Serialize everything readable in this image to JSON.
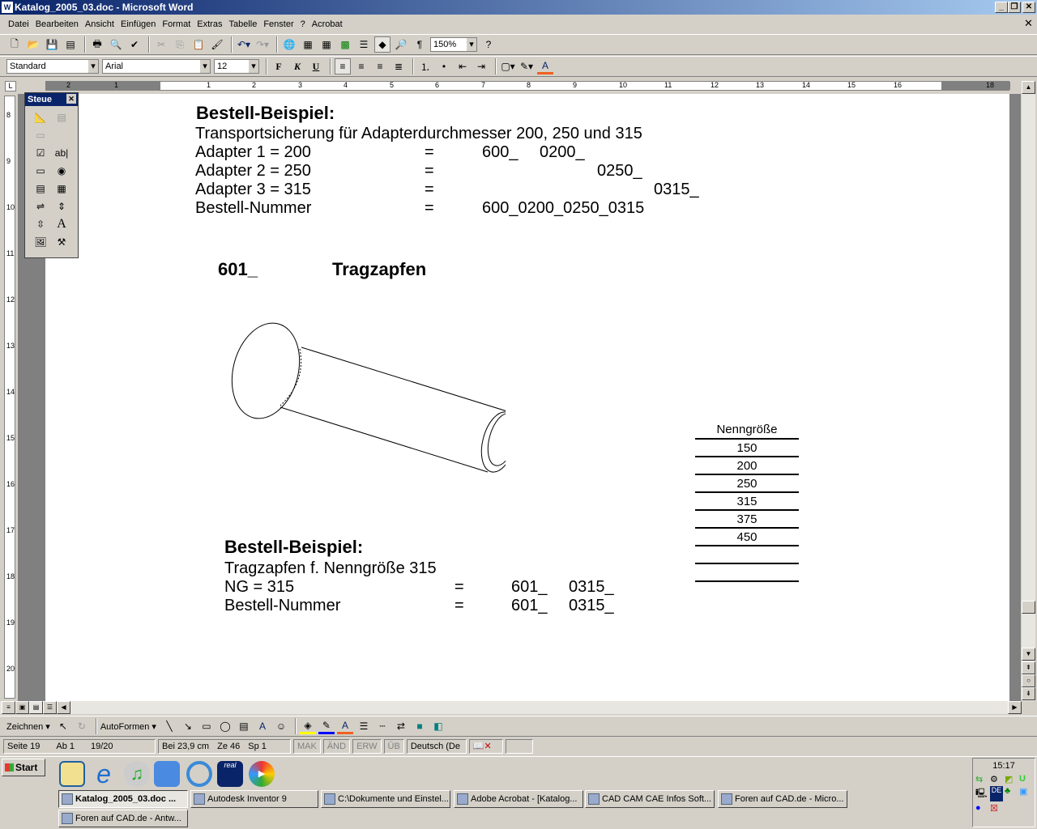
{
  "window": {
    "title": "Katalog_2005_03.doc - Microsoft Word"
  },
  "menu": [
    "Datei",
    "Bearbeiten",
    "Ansicht",
    "Einfügen",
    "Format",
    "Extras",
    "Tabelle",
    "Fenster",
    "?",
    "Acrobat"
  ],
  "toolbar": {
    "zoom": "150%",
    "style": "Standard",
    "font": "Arial",
    "size": "12",
    "bold": "F",
    "italic": "K",
    "underline": "U"
  },
  "ruler": {
    "h_ticks": [
      "2",
      "1",
      "1",
      "2",
      "3",
      "4",
      "5",
      "6",
      "7",
      "8",
      "9",
      "10",
      "11",
      "12",
      "13",
      "14",
      "15",
      "16",
      "18"
    ],
    "v_ticks": [
      "8",
      "9",
      "10",
      "11",
      "12",
      "13",
      "14",
      "15",
      "16",
      "17",
      "18",
      "19",
      "20"
    ]
  },
  "control_toolbox": {
    "title": "Steue"
  },
  "doc": {
    "sec1": {
      "heading": "Bestell-Beispiel:",
      "line1": "Transportsicherung für Adapterdurchmesser 200, 250 und 315",
      "rows": [
        {
          "label": "Adapter 1 = 200",
          "eq": "=",
          "a": "600_",
          "b": "0200_"
        },
        {
          "label": "Adapter 2 = 250",
          "eq": "=",
          "c": "0250_"
        },
        {
          "label": "Adapter 3 = 315",
          "eq": "=",
          "d": "0315_"
        },
        {
          "label": "Bestell-Nummer",
          "eq": "=",
          "a": "600_0200_0250_0315"
        }
      ]
    },
    "part": {
      "code": "601_",
      "name": "Tragzapfen"
    },
    "table": {
      "header": "Nenngröße",
      "values": [
        "150",
        "200",
        "250",
        "315",
        "375",
        "450",
        "",
        ""
      ]
    },
    "sec2": {
      "heading": "Bestell-Beispiel:",
      "line1": "Tragzapfen f. Nenngröße 315",
      "rows": [
        {
          "label": "NG = 315",
          "eq": "=",
          "a": "601_",
          "b": "0315_"
        },
        {
          "label": "Bestell-Nummer",
          "eq": "=",
          "a": "601_",
          "b": "0315_"
        }
      ]
    }
  },
  "drawing_toolbar": {
    "draw": "Zeichnen ▾",
    "autoshapes": "AutoFormen ▾"
  },
  "status": {
    "page": "Seite 19",
    "section": "Ab 1",
    "pages": "19/20",
    "at": "Bei 23,9 cm",
    "line": "Ze 46",
    "col": "Sp 1",
    "mak": "MAK",
    "and": "ÄND",
    "erw": "ERW",
    "ub": "ÜB",
    "lang": "Deutsch (De"
  },
  "taskbar": {
    "start": "Start",
    "clock": "15:17",
    "tasks": [
      "Katalog_2005_03.doc ...",
      "Autodesk Inventor 9",
      "C:\\Dokumente und Einstel...",
      "Adobe Acrobat - [Katalog...",
      "CAD CAM CAE Infos Soft...",
      "Foren auf CAD.de - Micro...",
      "Foren auf CAD.de - Antw..."
    ],
    "tray_lang": "DE"
  }
}
